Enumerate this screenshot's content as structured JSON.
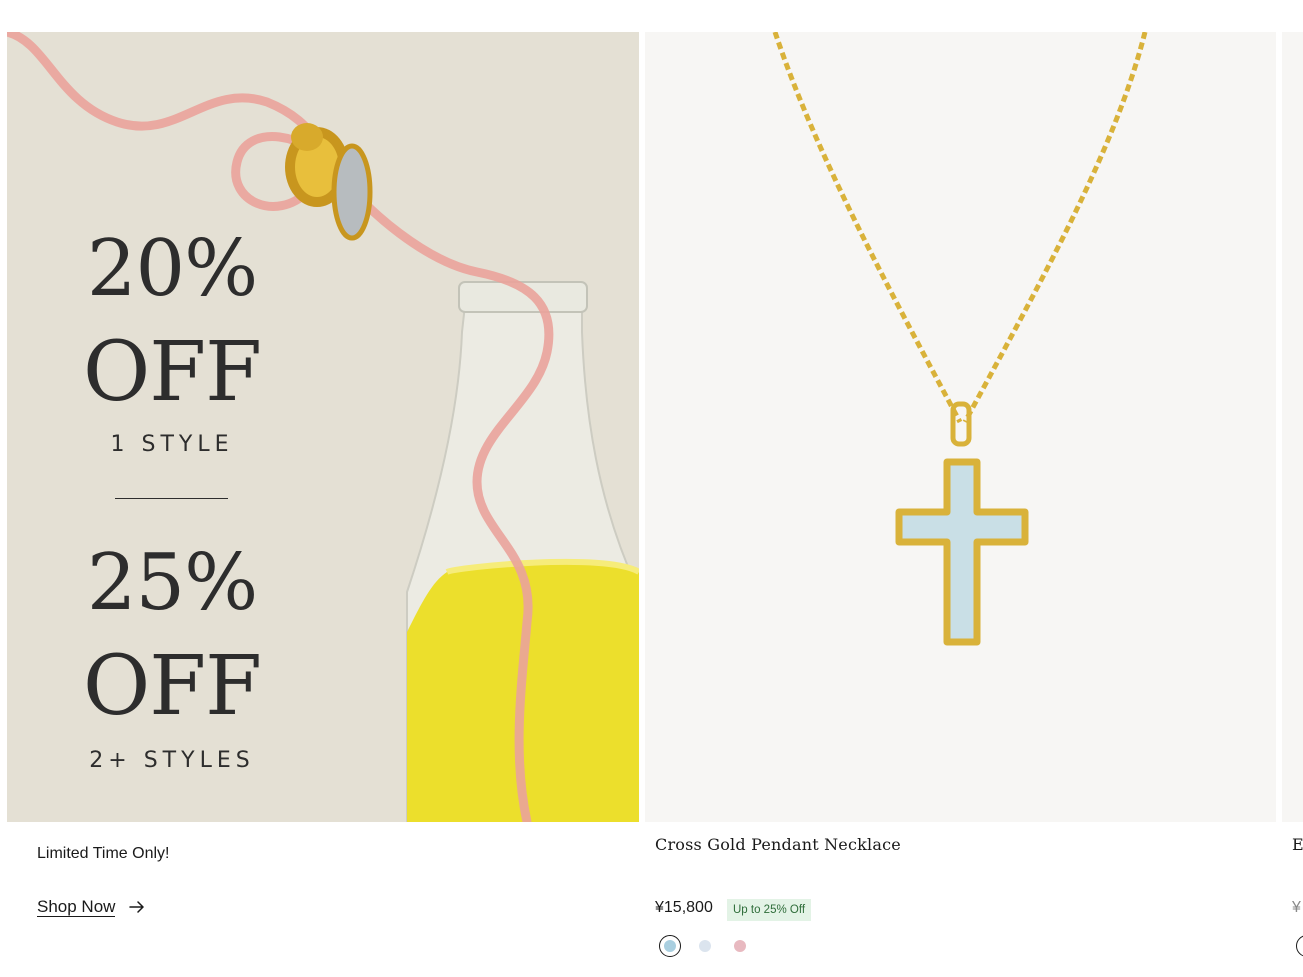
{
  "promo": {
    "line1": "20%",
    "line2": "OFF",
    "line3": "1 STYLE",
    "line4": "25%",
    "line5": "OFF",
    "line6": "2+ STYLES",
    "caption": "Limited Time Only!",
    "cta_label": "Shop Now",
    "cta_icon": "arrow-right-icon"
  },
  "product": {
    "name": "Cross Gold Pendant Necklace",
    "price": "¥15,800",
    "badge": "Up to 25% Off",
    "swatches": [
      {
        "name": "light-blue",
        "color": "#a9cfe0",
        "selected": true
      },
      {
        "name": "pale-blue",
        "color": "#dbe4ee",
        "selected": false
      },
      {
        "name": "pink",
        "color": "#e8b9c0",
        "selected": false
      }
    ]
  },
  "next_product": {
    "name_start": "E",
    "price_start": "¥"
  },
  "colors": {
    "promo_bg": "#e4e0d4",
    "product_bg": "#f7f6f4",
    "badge_bg": "#e3f3e6",
    "badge_text": "#2f6d3a",
    "gold": "#d9b23a",
    "enamel_blue": "#c9dfe6"
  }
}
